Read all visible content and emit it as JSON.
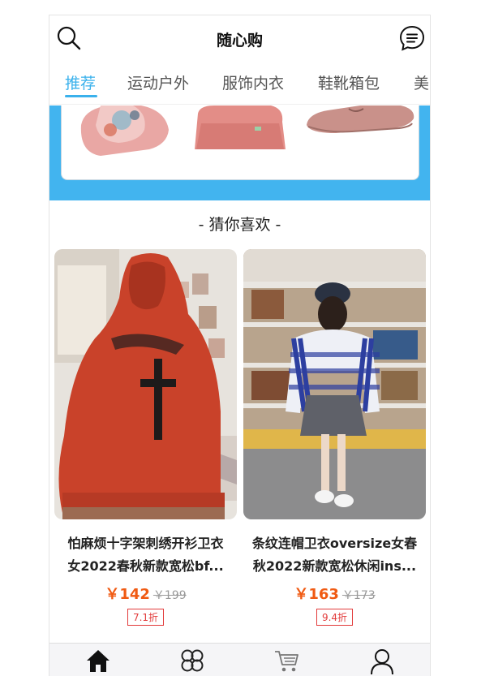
{
  "header": {
    "title": "随心购"
  },
  "tabs": [
    {
      "label": "推荐",
      "active": true
    },
    {
      "label": "运动户外"
    },
    {
      "label": "服饰内衣"
    },
    {
      "label": "鞋靴箱包"
    },
    {
      "label": "美"
    }
  ],
  "section": {
    "title": "-  猜你喜欢  -"
  },
  "products": [
    {
      "name_line1": "怕麻烦十字架刺绣开衫卫衣",
      "name_line2": "女2022春秋新款宽松bf...",
      "price": "￥142",
      "old_price": "￥199",
      "discount": "7.1折"
    },
    {
      "name_line1": "条纹连帽卫衣oversize女春",
      "name_line2": "秋2022新款宽松休闲ins...",
      "price": "￥163",
      "old_price": "￥173",
      "discount": "9.4折"
    }
  ],
  "colors": {
    "accent": "#3ab1ec",
    "banner": "#42b4ef",
    "price": "#f05a12",
    "discount": "#e23b3b"
  },
  "icons": [
    "search-icon",
    "message-icon",
    "home-icon",
    "category-icon",
    "cart-icon",
    "user-icon"
  ]
}
